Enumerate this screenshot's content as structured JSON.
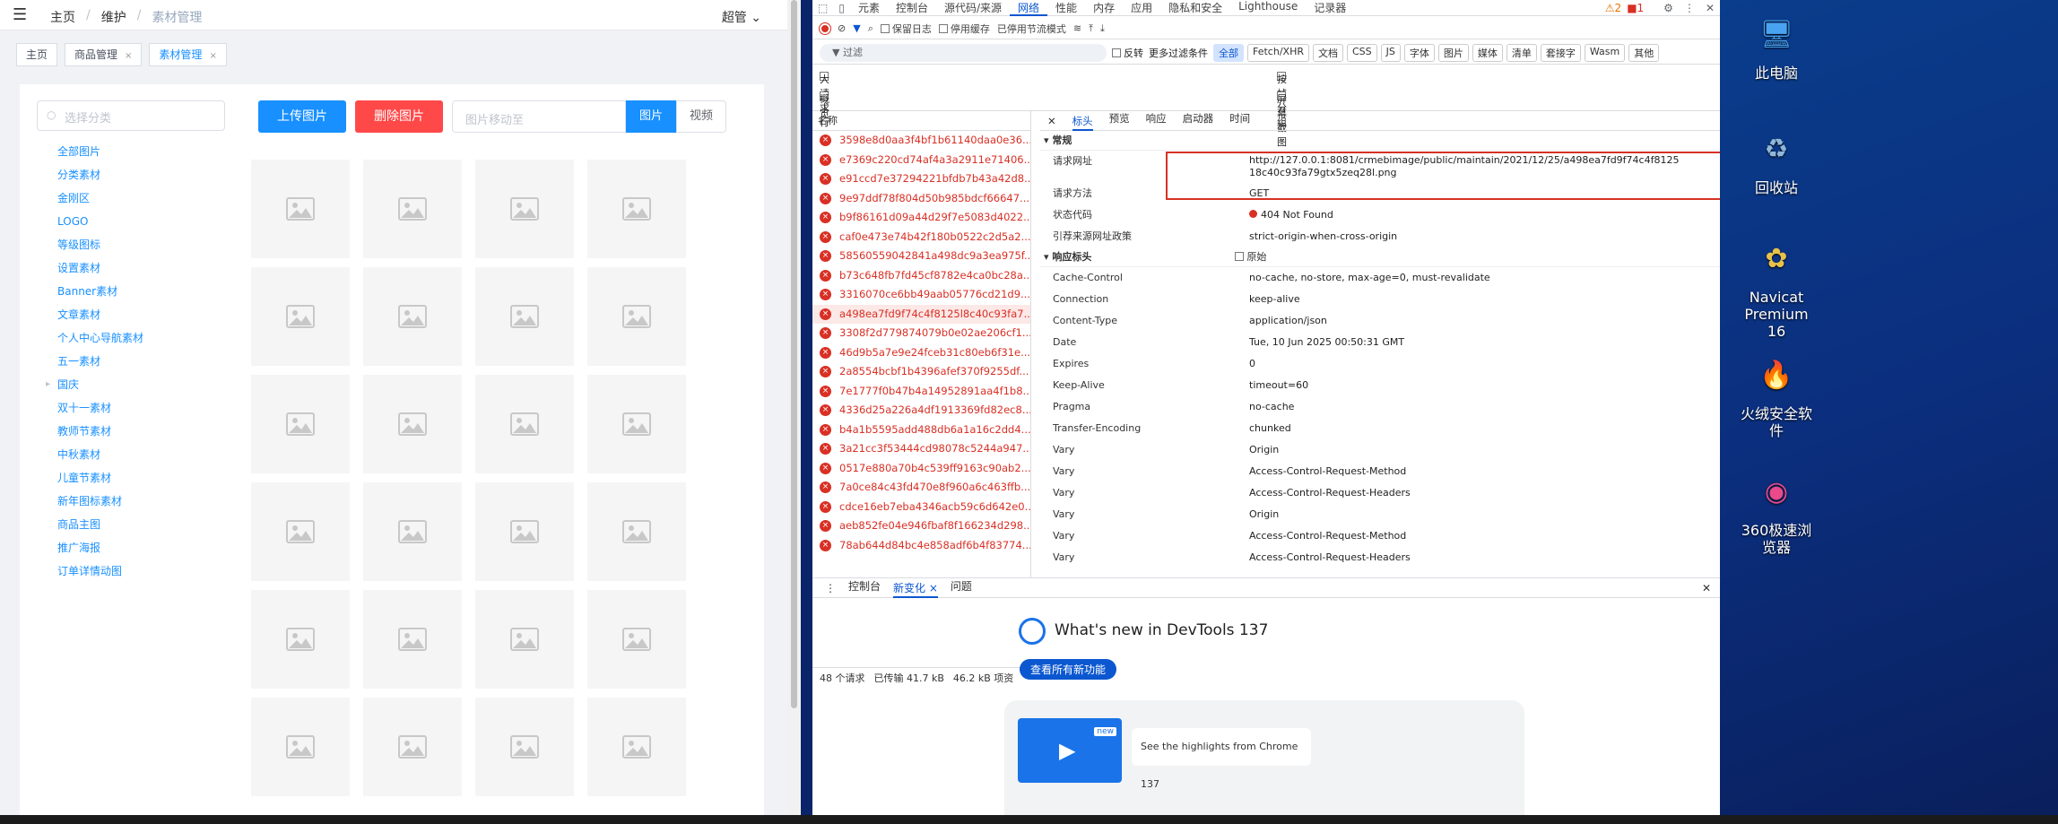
{
  "header": {
    "breadcrumb": [
      "主页",
      "维护",
      "素材管理"
    ],
    "user": "超管"
  },
  "tags": [
    {
      "label": "主页"
    },
    {
      "label": "商品管理",
      "close": "×"
    },
    {
      "label": "素材管理",
      "close": "×"
    }
  ],
  "panel": {
    "category_placeholder": "选择分类",
    "categories": [
      "全部图片",
      "分类素材",
      "金刚区",
      "LOGO",
      "等级图标",
      "设置素材",
      "Banner素材",
      "文章素材",
      "个人中心导航素材",
      "五一素材",
      "国庆",
      "双十一素材",
      "教师节素材",
      "中秋素材",
      "儿童节素材",
      "新年图标素材",
      "商品主图",
      "推广海报",
      "订单详情动图"
    ],
    "upload_label": "上传图片",
    "delete_label": "删除图片",
    "move_placeholder": "图片移动至",
    "seg_image": "图片",
    "seg_video": "视频",
    "thumb_count": 24
  },
  "devtools": {
    "tabs": [
      "元素",
      "控制台",
      "源代码/来源",
      "网络",
      "性能",
      "内存",
      "应用",
      "隐私和安全",
      "Lighthouse",
      "记录器"
    ],
    "selected_tab": "网络",
    "warn_count": "2",
    "err_count": "1",
    "toolbar": {
      "preserve_log": "保留日志",
      "disable_cache": "停用缓存",
      "throttle": "已停用节流模式"
    },
    "filter": {
      "placeholder": "过滤",
      "invert": "反转",
      "more": "更多过滤条件",
      "chips": [
        "全部",
        "Fetch/XHR",
        "文档",
        "CSS",
        "JS",
        "字体",
        "图片",
        "媒体",
        "清单",
        "套接字",
        "Wasm",
        "其他"
      ]
    },
    "options": {
      "big_rows": "大请求行",
      "overview": "概览",
      "group_by_frame": "按帧分组",
      "screenshots": "屏幕截图"
    },
    "list_header": "名称",
    "requests": [
      "3598e8d0aa3f4bf1b61140daa0e36...",
      "e7369c220cd74af4a3a2911e71406...",
      "e91ccd7e37294221bfdb7b43a42d8...",
      "9e97ddf78f804d50b985bdcf66647...",
      "b9f86161d09a44d29f7e5083d4022...",
      "caf0e473e74b42f180b0522c2d5a2...",
      "58560559042841a498dc9a3ea975f...",
      "b73c648fb7fd45cf8782e4ca0bc28a...",
      "3316070ce6bb49aab05776cd21d9...",
      "a498ea7fd9f74c4f8125l8c40c93fa7...",
      "3308f2d779874079b0e02ae206cf1...",
      "46d9b5a7e9e24fceb31c80eb6f31e...",
      "2a8554bcbf1b4396afef370f9255df...",
      "7e1777f0b47b4a14952891aa4f1b8...",
      "4336d25a226a4df1913369fd82ec8...",
      "b4a1b5595add488db6a1a16c2dd4...",
      "3a21cc3f53444cd98078c5244a947...",
      "0517e880a70b4c539ff9163c90ab2...",
      "7a0ce84c43fd470e8f960a6c463ffb...",
      "cdce16eb7eba4346acb59c6d642e0...",
      "aeb852fe04e946fbaf8f166234d298...",
      "78ab644d84bc4e858adf6b4f83774..."
    ],
    "summary": {
      "count": "48 个请求",
      "transferred": "已传输 41.7 kB",
      "resources": "46.2 kB 项资"
    },
    "detail_tabs": [
      "标头",
      "预览",
      "响应",
      "启动器",
      "时间"
    ],
    "general_title": "常规",
    "general": [
      {
        "k": "请求网址",
        "v": "http://127.0.0.1:8081/crmebimage/public/maintain/2021/12/25/a498ea7fd9f74c4f8125",
        "v2": "18c40c93fa79gtx5zeq28l.png"
      },
      {
        "k": "请求方法",
        "v": "GET"
      },
      {
        "k": "状态代码",
        "v": "404 Not Found"
      },
      {
        "k": "引荐来源网址政策",
        "v": "strict-origin-when-cross-origin"
      }
    ],
    "resp_title": "响应标头",
    "raw": "原始",
    "resp_headers": [
      {
        "k": "Cache-Control",
        "v": "no-cache, no-store, max-age=0, must-revalidate"
      },
      {
        "k": "Connection",
        "v": "keep-alive"
      },
      {
        "k": "Content-Type",
        "v": "application/json"
      },
      {
        "k": "Date",
        "v": "Tue, 10 Jun 2025 00:50:31 GMT"
      },
      {
        "k": "Expires",
        "v": "0"
      },
      {
        "k": "Keep-Alive",
        "v": "timeout=60"
      },
      {
        "k": "Pragma",
        "v": "no-cache"
      },
      {
        "k": "Transfer-Encoding",
        "v": "chunked"
      },
      {
        "k": "Vary",
        "v": "Origin"
      },
      {
        "k": "Vary",
        "v": "Access-Control-Request-Method"
      },
      {
        "k": "Vary",
        "v": "Access-Control-Request-Headers"
      },
      {
        "k": "Vary",
        "v": "Origin"
      },
      {
        "k": "Vary",
        "v": "Access-Control-Request-Method"
      },
      {
        "k": "Vary",
        "v": "Access-Control-Request-Headers"
      }
    ],
    "drawer": {
      "tabs": [
        "控制台",
        "新变化",
        "问题"
      ],
      "selected": "新变化",
      "whatsnew": "What's new in DevTools 137",
      "see_all": "查看所有新功能",
      "card_text": "See the highlights from Chrome 137",
      "card_badge": "new"
    }
  },
  "desktop": [
    {
      "label": "此电脑",
      "icon": "computer-icon"
    },
    {
      "label": "回收站",
      "icon": "recycle-bin-icon"
    },
    {
      "label": "Navicat Premium 16",
      "icon": "navicat-icon"
    },
    {
      "label": "火绒安全软件",
      "icon": "huorong-icon"
    },
    {
      "label": "360极速浏览器",
      "icon": "360-browser-icon"
    }
  ]
}
